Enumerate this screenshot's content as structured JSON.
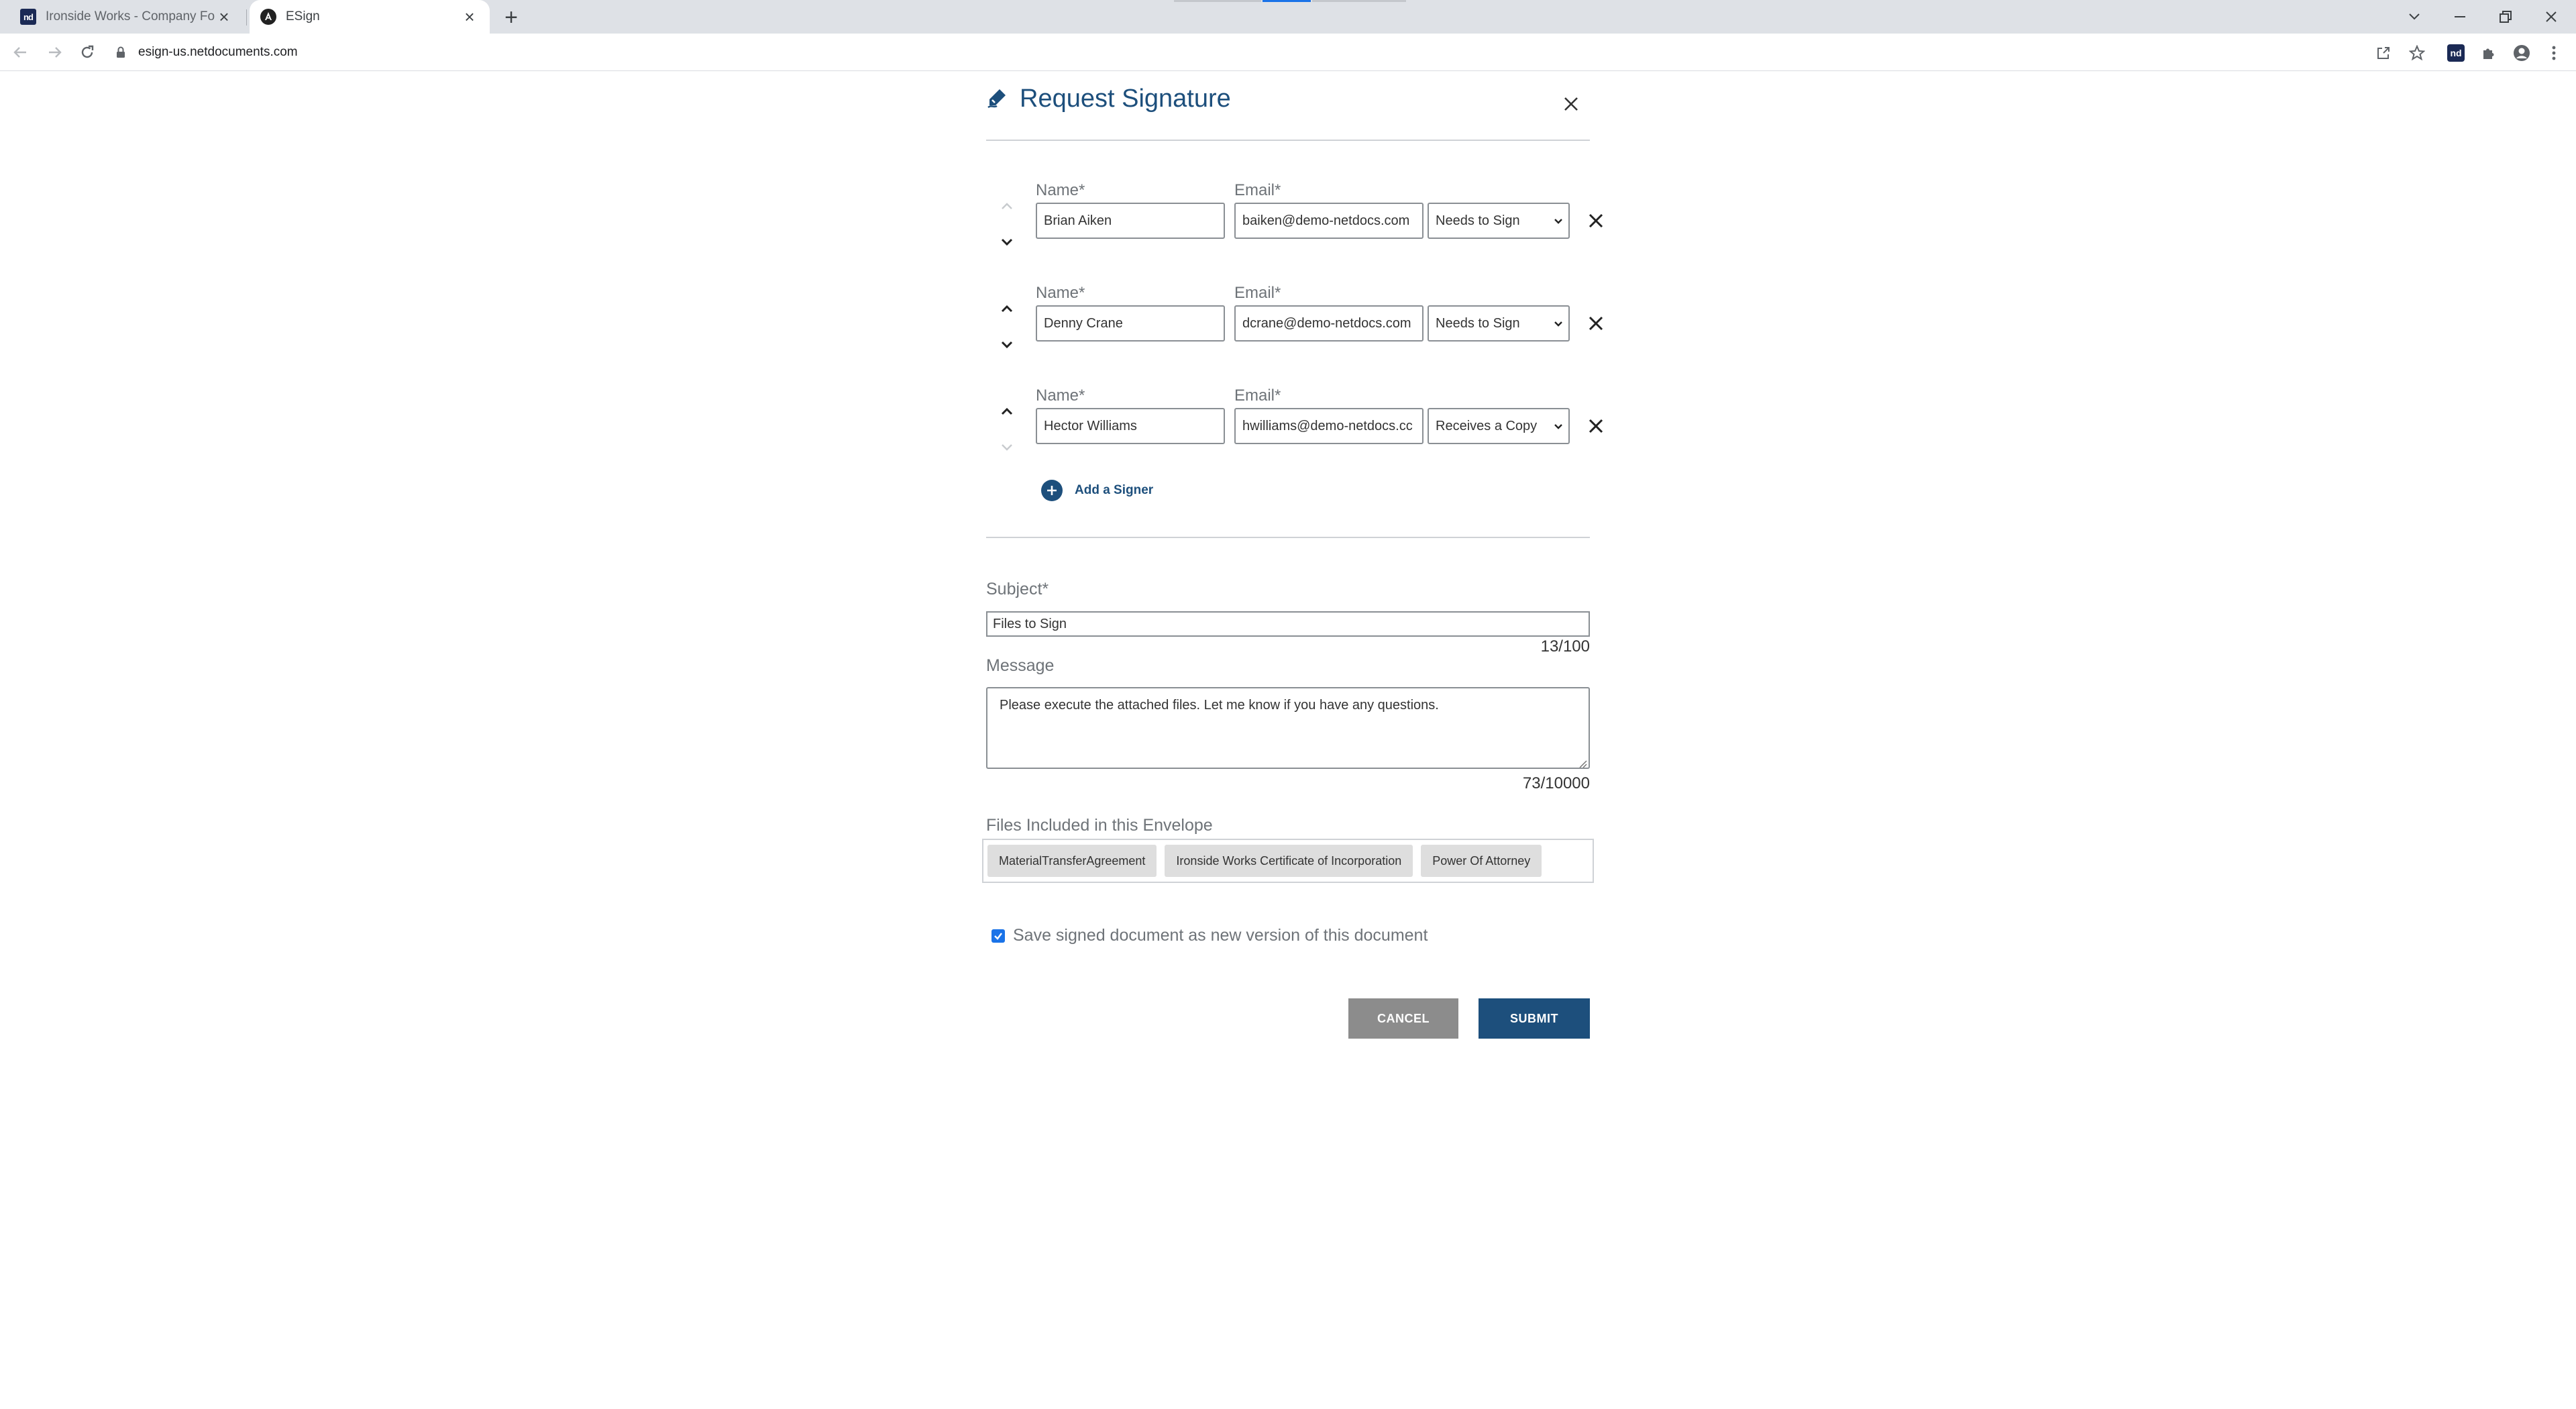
{
  "browser": {
    "tabs": [
      {
        "title": "Ironside Works - Company Form",
        "favicon": "nd-logo-icon",
        "active": false
      },
      {
        "title": "ESign",
        "favicon": "angular-logo-icon",
        "active": true
      }
    ],
    "url": "esign-us.netdocuments.com",
    "new_tab_symbol": "+"
  },
  "dialog": {
    "title": "Request Signature",
    "signers": [
      {
        "name_label": "Name*",
        "email_label": "Email*",
        "name": "Brian Aiken",
        "email": "baiken@demo-netdocs.com",
        "role": "Needs to Sign"
      },
      {
        "name_label": "Name*",
        "email_label": "Email*",
        "name": "Denny Crane",
        "email": "dcrane@demo-netdocs.com",
        "role": "Needs to Sign"
      },
      {
        "name_label": "Name*",
        "email_label": "Email*",
        "name": "Hector Williams",
        "email": "hwilliams@demo-netdocs.cc",
        "role": "Receives a Copy"
      }
    ],
    "add_signer_label": "Add a Signer",
    "subject_label": "Subject*",
    "subject_value": "Files to Sign",
    "subject_counter": "13/100",
    "message_label": "Message",
    "message_value": "Please execute the attached files. Let me know if you have any questions.",
    "message_counter": "73/10000",
    "files_label": "Files Included in this Envelope",
    "files": [
      "MaterialTransferAgreement",
      "Ironside Works Certificate of Incorporation",
      "Power Of Attorney"
    ],
    "save_version_label": "Save signed document as new version of this document",
    "save_version_checked": true,
    "cancel_label": "CANCEL",
    "submit_label": "SUBMIT"
  },
  "colors": {
    "accent": "#1d4f7c",
    "label_gray": "#6e7378",
    "cancel_gray": "#8c8c8c",
    "checkbox_blue": "#1a73e8"
  }
}
